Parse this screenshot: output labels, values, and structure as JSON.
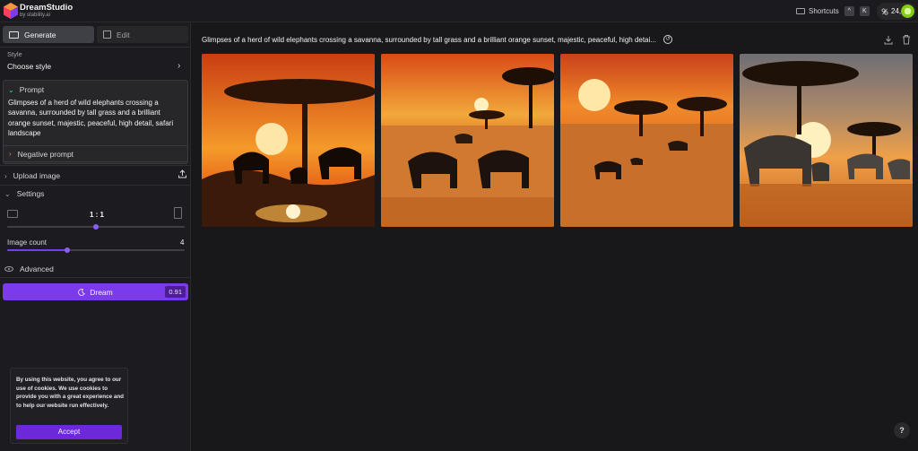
{
  "app": {
    "name": "DreamStudio",
    "subtitle": "by stability.ai"
  },
  "topbar": {
    "shortcuts_label": "Shortcuts",
    "shortcut_keys": [
      "^",
      "K"
    ],
    "credits": "24,1"
  },
  "tabs": {
    "generate": "Generate",
    "edit": "Edit"
  },
  "style": {
    "label": "Style",
    "value": "Choose style"
  },
  "prompt": {
    "label": "Prompt",
    "text": "Glimpses of a herd of wild elephants crossing a savanna, surrounded by tall grass and a brilliant orange sunset, majestic, peaceful, high detail, safari landscape"
  },
  "negative_prompt": {
    "label": "Negative prompt"
  },
  "upload": {
    "label": "Upload image"
  },
  "settings": {
    "label": "Settings",
    "aspect_ratio": "1 : 1",
    "aspect_ratio_level": 0.5,
    "image_count_label": "Image count",
    "image_count": "4",
    "image_count_level": 0.34,
    "advanced_label": "Advanced"
  },
  "dream": {
    "label": "Dream",
    "cost": "0.91"
  },
  "cookie": {
    "text": "By using this website, you agree to our use of cookies. We use cookies to provide you with a great experience and to help our website run effectively.",
    "accept": "Accept"
  },
  "main": {
    "headline": "Glimpses of a herd of wild elephants crossing a savanna, surrounded by tall grass and a brilliant orange sunset, majestic, peaceful, high detai...",
    "images": [
      {
        "name": "generated-image-1",
        "sky": [
          "#e8501a",
          "#f59a2a"
        ]
      },
      {
        "name": "generated-image-2",
        "sky": [
          "#d94a16",
          "#f2a83a"
        ]
      },
      {
        "name": "generated-image-3",
        "sky": [
          "#e0581c",
          "#f7b345"
        ]
      },
      {
        "name": "generated-image-4",
        "sky": [
          "#7a7a80",
          "#f0a048"
        ]
      }
    ]
  },
  "help": {
    "label": "?"
  },
  "colors": {
    "accent": "#7c3aed",
    "background": "#18181b",
    "panel": "#1c1c20"
  }
}
